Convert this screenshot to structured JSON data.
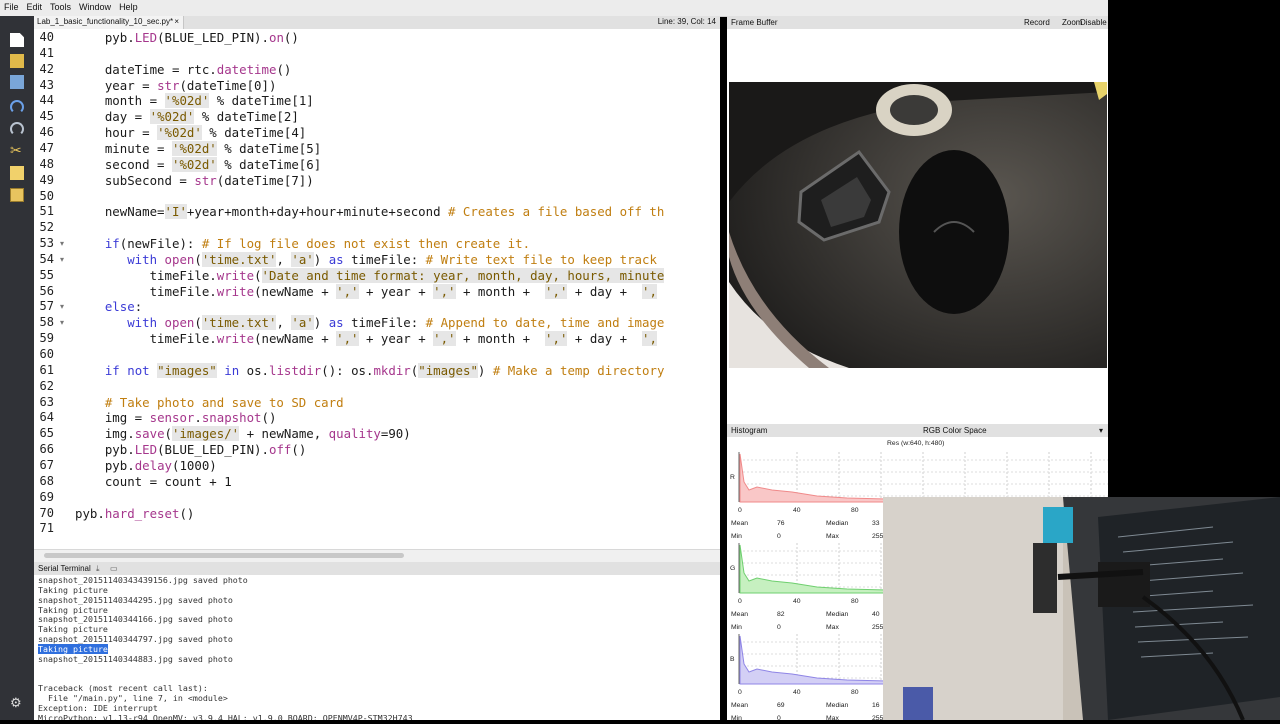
{
  "menu": [
    "File",
    "Edit",
    "Tools",
    "Window",
    "Help"
  ],
  "editor": {
    "tab_title": "Lab_1_basic_functionality_10_sec.py*",
    "tab_close": "×",
    "cursor_position": "Line: 39, Col: 14"
  },
  "code_lines": [
    {
      "n": "40",
      "text": "    pyb.LED(BLUE_LED_PIN).on()"
    },
    {
      "n": "41",
      "text": ""
    },
    {
      "n": "42",
      "text": "    dateTime = rtc.datetime()"
    },
    {
      "n": "43",
      "text": "    year = str(dateTime[0])"
    },
    {
      "n": "44",
      "text": "    month = '%02d' % dateTime[1]"
    },
    {
      "n": "45",
      "text": "    day = '%02d' % dateTime[2]"
    },
    {
      "n": "46",
      "text": "    hour = '%02d' % dateTime[4]"
    },
    {
      "n": "47",
      "text": "    minute = '%02d' % dateTime[5]"
    },
    {
      "n": "48",
      "text": "    second = '%02d' % dateTime[6]"
    },
    {
      "n": "49",
      "text": "    subSecond = str(dateTime[7])"
    },
    {
      "n": "50",
      "text": ""
    },
    {
      "n": "51",
      "text": "    newName='I'+year+month+day+hour+minute+second # Creates a file based off th"
    },
    {
      "n": "52",
      "text": ""
    },
    {
      "n": "53",
      "text": "    if(newFile): # If log file does not exist then create it."
    },
    {
      "n": "54",
      "text": "       with open('time.txt', 'a') as timeFile: # Write text file to keep track"
    },
    {
      "n": "55",
      "text": "          timeFile.write('Date and time format: year, month, day, hours, minute"
    },
    {
      "n": "56",
      "text": "          timeFile.write(newName + ',' + year + ',' + month +  ',' + day +  ',"
    },
    {
      "n": "57",
      "text": "    else:"
    },
    {
      "n": "58",
      "text": "       with open('time.txt', 'a') as timeFile: # Append to date, time and image"
    },
    {
      "n": "59",
      "text": "          timeFile.write(newName + ',' + year + ',' + month +  ',' + day +  ',"
    },
    {
      "n": "60",
      "text": ""
    },
    {
      "n": "61",
      "text": "    if not \"images\" in os.listdir(): os.mkdir(\"images\") # Make a temp directory"
    },
    {
      "n": "62",
      "text": ""
    },
    {
      "n": "63",
      "text": "    # Take photo and save to SD card"
    },
    {
      "n": "64",
      "text": "    img = sensor.snapshot()"
    },
    {
      "n": "65",
      "text": "    img.save('images/' + newName, quality=90)"
    },
    {
      "n": "66",
      "text": "    pyb.LED(BLUE_LED_PIN).off()"
    },
    {
      "n": "67",
      "text": "    pyb.delay(1000)"
    },
    {
      "n": "68",
      "text": "    count = count + 1"
    },
    {
      "n": "69",
      "text": ""
    },
    {
      "n": "70",
      "text": "pyb.hard_reset()"
    },
    {
      "n": "71",
      "text": ""
    }
  ],
  "terminal": {
    "title": "Serial Terminal",
    "lines": [
      "snapshot_20151140343439156.jpg saved photo",
      "Taking picture",
      "snapshot_20151140344295.jpg saved photo",
      "Taking picture",
      "snapshot_20151140344166.jpg saved photo",
      "Taking picture",
      "snapshot_20151140344797.jpg saved photo",
      "Taking picture",
      "snapshot_20151140344883.jpg saved photo",
      "",
      "",
      "Traceback (most recent call last):",
      "  File \"/main.py\", line 7, in <module>",
      "Exception: IDE interrupt",
      "MicroPython: v1.13-r94 OpenMV: v3.9.4 HAL: v1.9.0 BOARD: OPENMV4P-STM32H743"
    ],
    "highlighted_line": 7
  },
  "framebuffer": {
    "title": "Frame Buffer",
    "record": "Record",
    "zoom": "Zoom",
    "disable": "Disable"
  },
  "histogram": {
    "title": "Histogram",
    "color_space": "RGB Color Space",
    "resolution": "Res (w:640, h:480)",
    "ticks": [
      "0",
      "40",
      "80"
    ],
    "channels": [
      {
        "label": "R",
        "color": "#f08a8a",
        "fill": "#f9c7c7",
        "mean": "76",
        "median": "33",
        "min": "0",
        "max": "255"
      },
      {
        "label": "G",
        "color": "#6fcf6f",
        "fill": "#c6f0c0",
        "mean": "82",
        "median": "40",
        "min": "0",
        "max": "255"
      },
      {
        "label": "B",
        "color": "#8f85e6",
        "fill": "#d3cff5",
        "mean": "69",
        "median": "16",
        "min": "0",
        "max": "255"
      }
    ],
    "labels": {
      "mean": "Mean",
      "median": "Median",
      "min": "Min",
      "max": "Max"
    }
  }
}
